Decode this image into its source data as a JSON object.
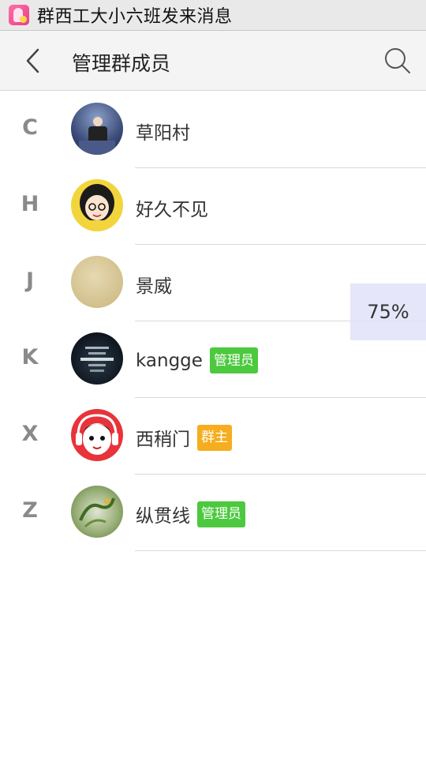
{
  "notification": {
    "app_icon": "pink-app-icon",
    "text": "群西工大小六班发来消息"
  },
  "header": {
    "back_icon": "chevron-left-icon",
    "title": "管理群成员",
    "search_icon": "search-icon"
  },
  "members": [
    {
      "letter": "C",
      "name": "草阳村",
      "badge": ""
    },
    {
      "letter": "H",
      "name": "好久不见",
      "badge": ""
    },
    {
      "letter": "J",
      "name": "景威",
      "badge": ""
    },
    {
      "letter": "K",
      "name": "kangge",
      "badge": "管理员"
    },
    {
      "letter": "X",
      "name": "西稍门",
      "badge": "群主"
    },
    {
      "letter": "Z",
      "name": "纵贯线",
      "badge": "管理员"
    }
  ],
  "zoom_indicator": "75%",
  "colors": {
    "admin_badge": "#4cc93e",
    "owner_badge": "#f6ad1f",
    "letter": "#8a8a8a"
  }
}
